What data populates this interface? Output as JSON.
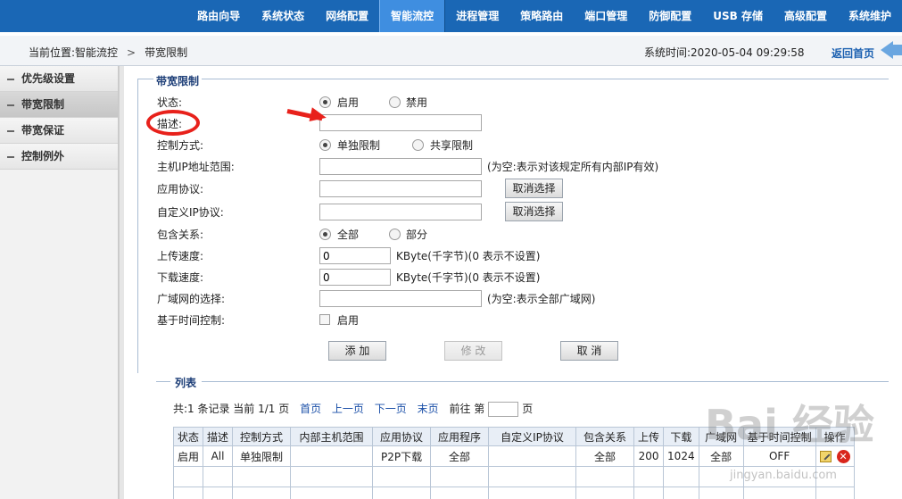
{
  "nav": {
    "items": [
      "路由向导",
      "系统状态",
      "网络配置",
      "智能流控",
      "进程管理",
      "策略路由",
      "端口管理",
      "防御配置",
      "USB 存储",
      "高级配置",
      "系统维护"
    ],
    "active_index": 3
  },
  "breadcrumb": {
    "location": "当前位置:智能流控",
    "sep": ">",
    "current": "带宽限制",
    "systime": "系统时间:2020-05-04 09:29:58",
    "home": "返回首页"
  },
  "sidebar": {
    "items": [
      "优先级设置",
      "带宽限制",
      "带宽保证",
      "控制例外"
    ],
    "active_index": 1
  },
  "form": {
    "legend": "带宽限制",
    "status_label": "状态:",
    "status_on": "启用",
    "status_off": "禁用",
    "desc_label": "描述:",
    "desc_value": "",
    "mode_label": "控制方式:",
    "mode_single": "单独限制",
    "mode_shared": "共享限制",
    "ip_label": "主机IP地址范围:",
    "ip_value": "",
    "ip_hint": "(为空:表示对该规定所有内部IP有效)",
    "app_label": "应用协议:",
    "app_value": "",
    "app_cancel": "取消选择",
    "custom_label": "自定义IP协议:",
    "custom_value": "",
    "custom_cancel": "取消选择",
    "incl_label": "包含关系:",
    "incl_all": "全部",
    "incl_part": "部分",
    "up_label": "上传速度:",
    "up_value": "0",
    "up_unit": "KByte(千字节)(0 表示不设置)",
    "down_label": "下载速度:",
    "down_value": "0",
    "down_unit": "KByte(千字节)(0 表示不设置)",
    "wan_label": "广域网的选择:",
    "wan_value": "",
    "wan_hint": "(为空:表示全部广域网)",
    "time_label": "基于时间控制:",
    "time_enable": "启用",
    "btn_add": "添 加",
    "btn_modify": "修 改",
    "btn_cancel": "取 消"
  },
  "list": {
    "legend": "列表",
    "summary": "共:1 条记录 当前 1/1 页",
    "first": "首页",
    "prev": "上一页",
    "next": "下一页",
    "last": "末页",
    "goto_pre": "前往 第",
    "goto_post": "页",
    "headers": [
      "状态",
      "描述",
      "控制方式",
      "内部主机范围",
      "应用协议",
      "应用程序",
      "自定义IP协议",
      "包含关系",
      "上传",
      "下载",
      "广域网",
      "基于时间控制",
      "操作"
    ],
    "rows": [
      [
        "启用",
        "All",
        "单独限制",
        "",
        "P2P下载",
        "全部",
        "",
        "全部",
        "200",
        "1024",
        "全部",
        "OFF"
      ]
    ]
  },
  "watermark": {
    "main": "Bai 经验",
    "sub": "jingyan.baidu.com"
  }
}
